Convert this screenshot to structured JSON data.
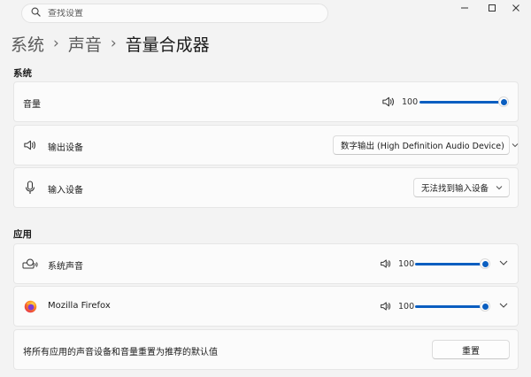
{
  "search": {
    "placeholder": "查找设置"
  },
  "breadcrumb": {
    "items": [
      "系统",
      "声音"
    ],
    "current": "音量合成器"
  },
  "sections": {
    "system": "系统",
    "apps": "应用"
  },
  "system": {
    "volume": {
      "label": "音量",
      "value": "100",
      "level": 100
    },
    "output": {
      "label": "输出设备",
      "selected": "数字输出 (High Definition Audio Device)"
    },
    "input": {
      "label": "输入设备",
      "selected": "无法找到输入设备"
    }
  },
  "apps": [
    {
      "name": "系统声音",
      "icon": "system-sounds-icon",
      "volume": "100",
      "level": 100
    },
    {
      "name": "Mozilla Firefox",
      "icon": "firefox-icon",
      "volume": "100",
      "level": 100
    }
  ],
  "reset": {
    "description": "将所有应用的声音设备和音量重置为推荐的默认值",
    "button_label": "重置"
  },
  "colors": {
    "accent": "#0a5ec0",
    "background": "#f3f3f3",
    "card": "#fbfbfb"
  }
}
